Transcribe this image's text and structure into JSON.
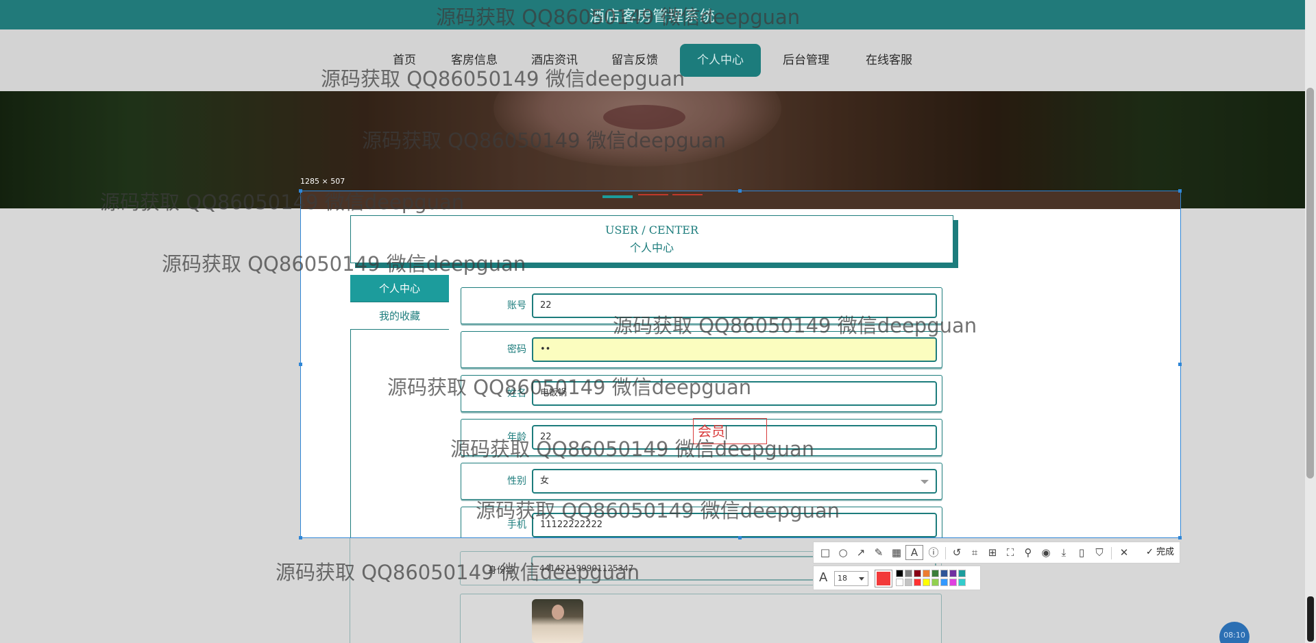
{
  "site": {
    "title": "酒店客房管理系统",
    "nav": [
      "首页",
      "客房信息",
      "酒店资讯",
      "留言反馈",
      "个人中心",
      "后台管理",
      "在线客服"
    ],
    "active_nav": "个人中心"
  },
  "capture": {
    "size_label": "1285 × 507"
  },
  "user_center": {
    "title_en": "USER / CENTER",
    "title_cn": "个人中心",
    "menu": [
      "个人中心",
      "我的收藏"
    ],
    "fields": [
      {
        "label": "账号",
        "value": "22"
      },
      {
        "label": "密码",
        "value": "••"
      },
      {
        "label": "姓名",
        "value": "电饭锅"
      },
      {
        "label": "年龄",
        "value": "22"
      },
      {
        "label": "性别",
        "value": "女"
      },
      {
        "label": "手机",
        "value": "11122222222"
      }
    ],
    "hidden_field": {
      "label": "身份证",
      "value": "441421199901125347"
    },
    "annotation_text": "会员"
  },
  "chat": {
    "label": "08:10"
  },
  "toolbar": {
    "icons": [
      "rectangle-icon",
      "ellipse-icon",
      "arrow-icon",
      "pen-icon",
      "mosaic-icon",
      "text-icon",
      "number-icon",
      "undo-icon",
      "crop-icon",
      "ocr-icon",
      "fullscreen-icon",
      "pin-icon",
      "download-icon",
      "save-icon",
      "bookmark-icon",
      "close-icon"
    ],
    "done_label": "完成",
    "font_size": "18",
    "current_color": "#f23a3a",
    "palette": [
      "#000000",
      "#7f7f7f",
      "#880015",
      "#ed7d31",
      "#3a7d3a",
      "#2f5597",
      "#7030a0",
      "#1c9c9c",
      "#ffffff",
      "#c3c3c3",
      "#ff3333",
      "#ffff00",
      "#92d050",
      "#3399ff",
      "#e040e0",
      "#33cccc"
    ]
  },
  "watermark": {
    "text": "源码获取 QQ86050149 微信deepguan"
  }
}
